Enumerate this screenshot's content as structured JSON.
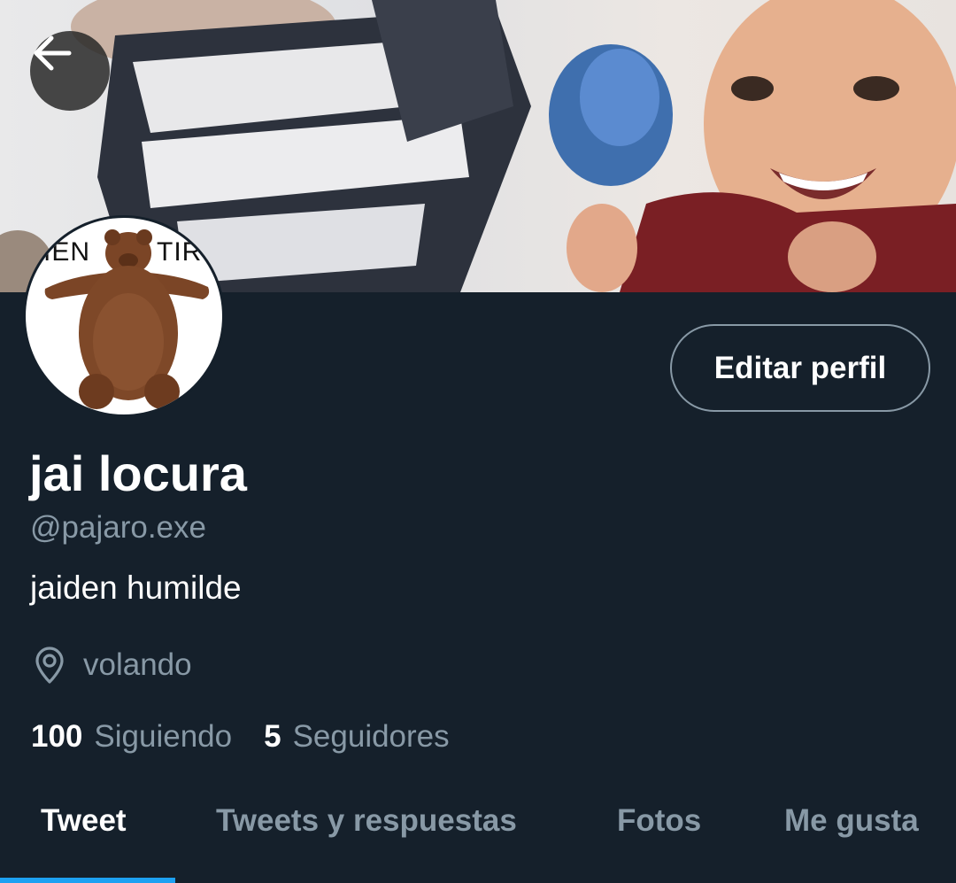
{
  "header": {
    "back_icon": "arrow-left-icon"
  },
  "profile": {
    "avatar_text_left": "IEN",
    "avatar_text_right": "TIR",
    "edit_label": "Editar perfil",
    "display_name": "jai locura",
    "handle": "@pajaro.exe",
    "bio": "jaiden humilde",
    "location_icon": "location-pin-icon",
    "location": "volando"
  },
  "stats": {
    "following_count": "100",
    "following_label": "Siguiendo",
    "followers_count": "5",
    "followers_label": "Seguidores"
  },
  "tabs": [
    {
      "label": "Tweet",
      "active": true
    },
    {
      "label": "Tweets y respuestas",
      "active": false
    },
    {
      "label": "Fotos",
      "active": false
    },
    {
      "label": "Me gusta",
      "active": false
    }
  ],
  "colors": {
    "background": "#15202b",
    "accent": "#1da1f2",
    "secondary_text": "#8899a6"
  }
}
